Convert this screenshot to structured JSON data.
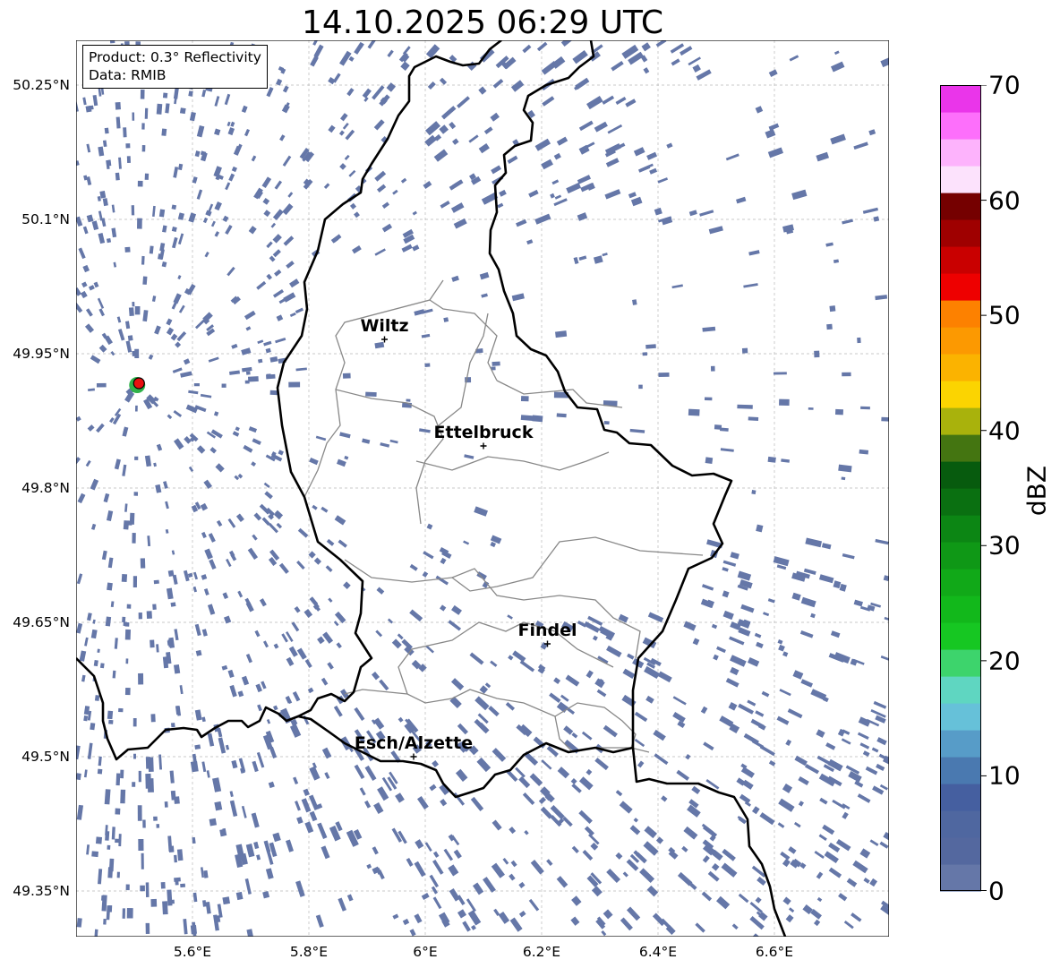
{
  "title": "14.10.2025 06:29 UTC",
  "info": {
    "product": "Product: 0.3° Reflectivity",
    "source": "Data: RMIB"
  },
  "map": {
    "lon_range": [
      5.4,
      6.8
    ],
    "lat_range": [
      49.3,
      50.3
    ],
    "x_ticks": [
      "5.6°E",
      "5.8°E",
      "6°E",
      "6.2°E",
      "6.4°E",
      "6.6°E"
    ],
    "x_tick_values": [
      5.6,
      5.8,
      6.0,
      6.2,
      6.4,
      6.6
    ],
    "y_ticks": [
      "50.25°N",
      "50.1°N",
      "49.95°N",
      "49.8°N",
      "49.65°N",
      "49.5°N",
      "49.35°N"
    ],
    "y_tick_values": [
      50.25,
      50.1,
      49.95,
      49.8,
      49.65,
      49.5,
      49.35
    ],
    "grid": true,
    "cities": [
      {
        "name": "Wiltz",
        "lon": 5.93,
        "lat": 49.966
      },
      {
        "name": "Ettelbruck",
        "lon": 6.1,
        "lat": 49.847
      },
      {
        "name": "Findel",
        "lon": 6.21,
        "lat": 49.626
      },
      {
        "name": "Esch/Alzette",
        "lon": 5.98,
        "lat": 49.5
      }
    ],
    "radar_site": {
      "lon": 5.505,
      "lat": 49.915,
      "color": "#e81010"
    },
    "echo_color": "#6577a8"
  },
  "colorbar": {
    "label": "dBZ",
    "ticks": [
      "0",
      "10",
      "20",
      "30",
      "40",
      "50",
      "60",
      "70"
    ],
    "colors": [
      "#6577a8",
      "#54689f",
      "#4f67a0",
      "#455fa0",
      "#4a79b0",
      "#579cc8",
      "#66c1d9",
      "#5fd6c1",
      "#3dd46c",
      "#16c722",
      "#12b81b",
      "#11a918",
      "#0f9816",
      "#0c8614",
      "#0a7011",
      "#075b0e",
      "#447511",
      "#a9b20c",
      "#fbd401",
      "#fbb300",
      "#fc9901",
      "#fd8100",
      "#ee0000",
      "#c90000",
      "#9f0000",
      "#750000",
      "#fce2fc",
      "#fdb3fc",
      "#fd6ffb",
      "#ea35ea"
    ]
  }
}
